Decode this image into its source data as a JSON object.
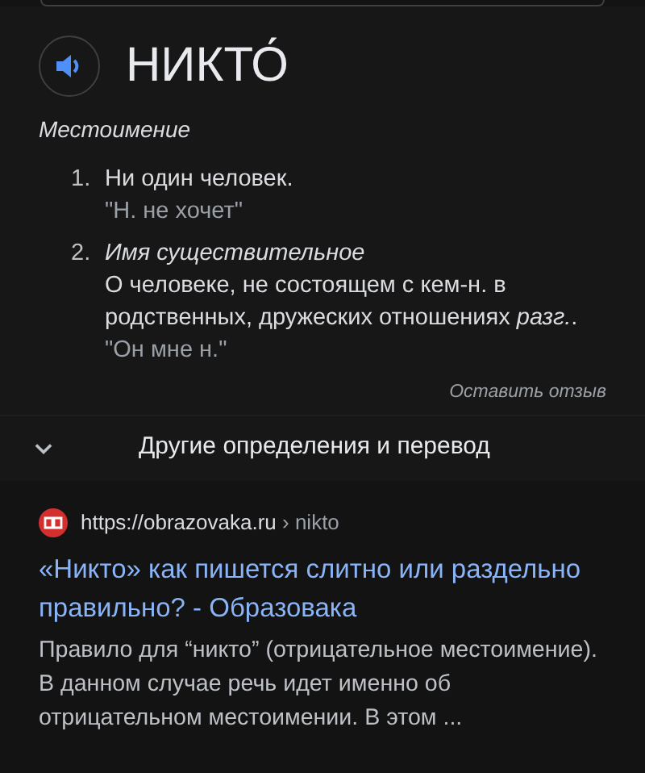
{
  "word": "НИКТО́",
  "part_of_speech": "Местоимение",
  "definitions": [
    {
      "number": "1.",
      "text": "Ни один человек.",
      "example": "\"Н. не хочет\""
    },
    {
      "number": "2.",
      "label": "Имя существительное",
      "text": "О человеке, не состоящем с кем-н. в родственных, дружеских отношениях *разг.*.",
      "example": "\"Он мне н.\""
    }
  ],
  "feedback_link": "Оставить отзыв",
  "more": {
    "label": "Другие определения и перевод",
    "expanded": false
  },
  "result": {
    "url": "https://obrazovaka.ru",
    "path": "› nikto",
    "title": "«Никто» как пишется слитно или раздельно правильно? - Образовака",
    "snippet": "Правило для “никто” (отрицательное местоимение). В данном случае речь идет именно об отрицательном местоимении. В этом ..."
  }
}
